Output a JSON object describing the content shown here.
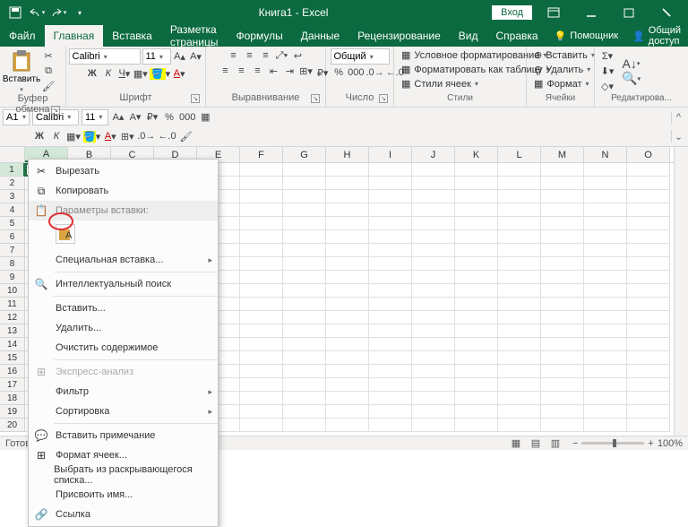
{
  "title": "Книга1 - Excel",
  "signin": "Вход",
  "tabs": {
    "file": "Файл",
    "home": "Главная",
    "insert": "Вставка",
    "layout": "Разметка страницы",
    "formulas": "Формулы",
    "data": "Данные",
    "review": "Рецензирование",
    "view": "Вид",
    "help": "Справка",
    "tellme": "Помощник",
    "share": "Общий доступ"
  },
  "ribbon": {
    "clipboard": {
      "label": "Буфер обмена",
      "paste": "Вставить"
    },
    "font": {
      "label": "Шрифт",
      "name": "Calibri",
      "size": "11",
      "bold": "Ж",
      "italic": "К",
      "underline": "Ч"
    },
    "alignment": {
      "label": "Выравнивание"
    },
    "number": {
      "label": "Число",
      "format": "Общий"
    },
    "styles": {
      "label": "Стили",
      "condfmt": "Условное форматирование",
      "astable": "Форматировать как таблицу",
      "cellstyles": "Стили ячеек"
    },
    "cells": {
      "label": "Ячейки",
      "insert": "Вставить",
      "delete": "Удалить",
      "format": "Формат"
    },
    "editing": {
      "label": "Редактирова..."
    }
  },
  "mini": {
    "font": "Calibri",
    "size": "11",
    "pct": "%",
    "sep": "000",
    "bold": "Ж",
    "italic": "К"
  },
  "namebox": "A1",
  "cols": [
    "A",
    "B",
    "C",
    "D",
    "E",
    "F",
    "G",
    "H",
    "I",
    "J",
    "K",
    "L",
    "M",
    "N",
    "O"
  ],
  "rowcount": 20,
  "ctx": {
    "cut": "Вырезать",
    "copy": "Копировать",
    "pasteopts": "Параметры вставки:",
    "pspecial": "Специальная вставка...",
    "smart": "Интеллектуальный поиск",
    "insert": "Вставить...",
    "delete": "Удалить...",
    "clear": "Очистить содержимое",
    "quick": "Экспресс-анализ",
    "filter": "Фильтр",
    "sort": "Сортировка",
    "comment": "Вставить примечание",
    "format": "Формат ячеек...",
    "dropdown": "Выбрать из раскрывающегося списка...",
    "name": "Присвоить имя...",
    "link": "Ссылка"
  },
  "status": {
    "ready": "Готово",
    "zoom": "100%"
  },
  "chart_data": null
}
